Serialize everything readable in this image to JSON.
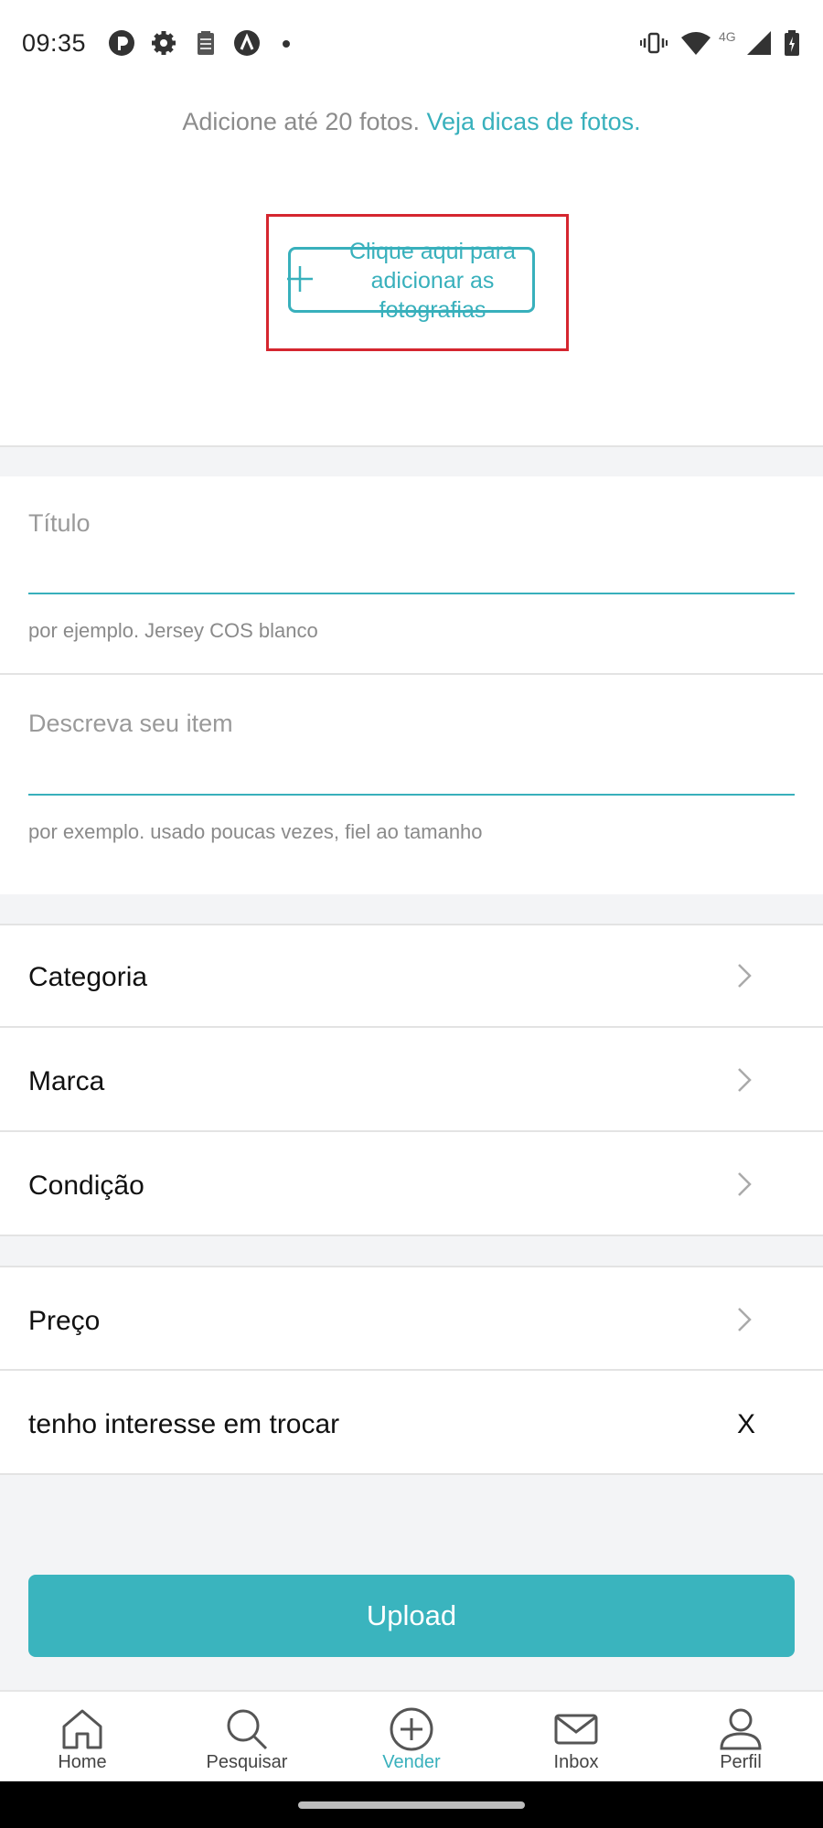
{
  "status_bar": {
    "time": "09:35",
    "network": "4G"
  },
  "photos": {
    "hint_text": "Adicione até 20 fotos.",
    "hint_link": "Veja dicas de fotos.",
    "add_label": "Clique aqui para adicionar as fotografias"
  },
  "form": {
    "title_label": "Título",
    "title_hint": "por ejemplo. Jersey COS blanco",
    "description_label": "Descreva seu item",
    "description_hint": "por exemplo. usado poucas vezes, fiel ao tamanho"
  },
  "rows": {
    "category": "Categoria",
    "brand": "Marca",
    "condition": "Condição",
    "price": "Preço",
    "trade": "tenho interesse em trocar",
    "trade_value": "X"
  },
  "upload_label": "Upload",
  "nav": {
    "home": "Home",
    "search": "Pesquisar",
    "sell": "Vender",
    "inbox": "Inbox",
    "profile": "Perfil",
    "active": "Vender"
  },
  "colors": {
    "accent": "#38b0bc",
    "highlight": "#d5262f",
    "band": "#f3f4f6"
  },
  "icons": [
    "vibrate-icon",
    "wifi-icon",
    "signal-icon",
    "battery-icon",
    "chevron-right-icon",
    "plus-icon",
    "home-icon",
    "search-icon",
    "plus-circle-icon",
    "mail-icon",
    "user-icon"
  ]
}
